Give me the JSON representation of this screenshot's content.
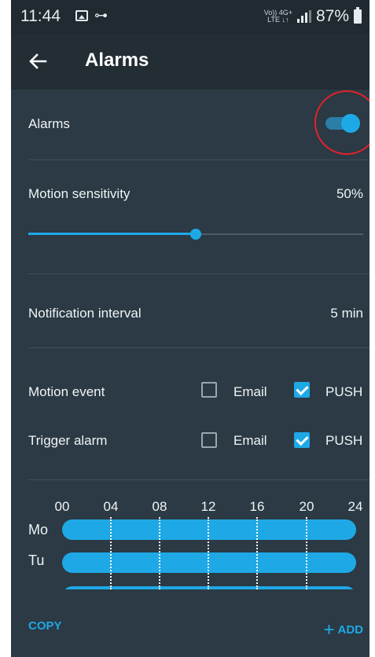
{
  "status_bar": {
    "time": "11:44",
    "network_top": "Vo)) 4G+",
    "network_bottom": "LTE ↓↑",
    "battery": "87%"
  },
  "header": {
    "title": "Alarms"
  },
  "alarms": {
    "label": "Alarms",
    "enabled": true
  },
  "motion_sensitivity": {
    "label": "Motion sensitivity",
    "value_text": "50%",
    "value": 50
  },
  "notification_interval": {
    "label": "Notification interval",
    "value": "5 min"
  },
  "events": [
    {
      "label": "Motion event",
      "email_label": "Email",
      "email_checked": false,
      "push_label": "PUSH",
      "push_checked": true
    },
    {
      "label": "Trigger alarm",
      "email_label": "Email",
      "email_checked": false,
      "push_label": "PUSH",
      "push_checked": true
    }
  ],
  "schedule": {
    "hours": [
      "00",
      "04",
      "08",
      "12",
      "16",
      "20",
      "24"
    ],
    "days": [
      "Mo",
      "Tu"
    ]
  },
  "footer": {
    "copy_label": "COPY",
    "add_label": "ADD"
  },
  "colors": {
    "accent": "#1ea9e6",
    "background": "#2b3a44",
    "header": "#222d34",
    "highlight_circle": "#e3222a"
  },
  "icons": {
    "back": "arrow-left-icon",
    "add": "plus-icon",
    "image": "image-icon",
    "key": "key-icon"
  }
}
